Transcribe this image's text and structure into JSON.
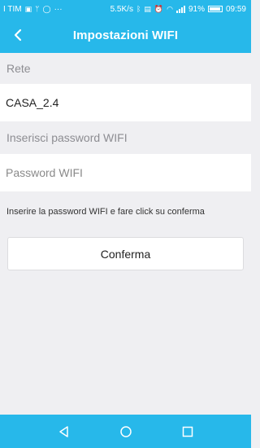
{
  "status_bar": {
    "carrier": "I TIM",
    "extra_icons": [
      "message-icon",
      "usb-icon",
      "whatsapp-icon"
    ],
    "dots": "···",
    "speed": "5.5K/s",
    "battery": "91%",
    "time": "09:59"
  },
  "header": {
    "title": "Impostazioni WIFI",
    "back_icon": "chevron-left-icon"
  },
  "form": {
    "network_label": "Rete",
    "network_value": "CASA_2.4",
    "password_label": "Inserisci password WIFI",
    "password_placeholder": "Password WIFI",
    "password_value": "",
    "hint": "Inserire la password WIFI e fare click su conferma",
    "confirm_label": "Conferma"
  },
  "nav_bar": {
    "back_icon": "triangle-back-icon",
    "home_icon": "circle-home-icon",
    "recents_icon": "square-recents-icon"
  },
  "colors": {
    "accent": "#27b8ea",
    "background": "#efeff2",
    "label": "#8d8d92"
  }
}
